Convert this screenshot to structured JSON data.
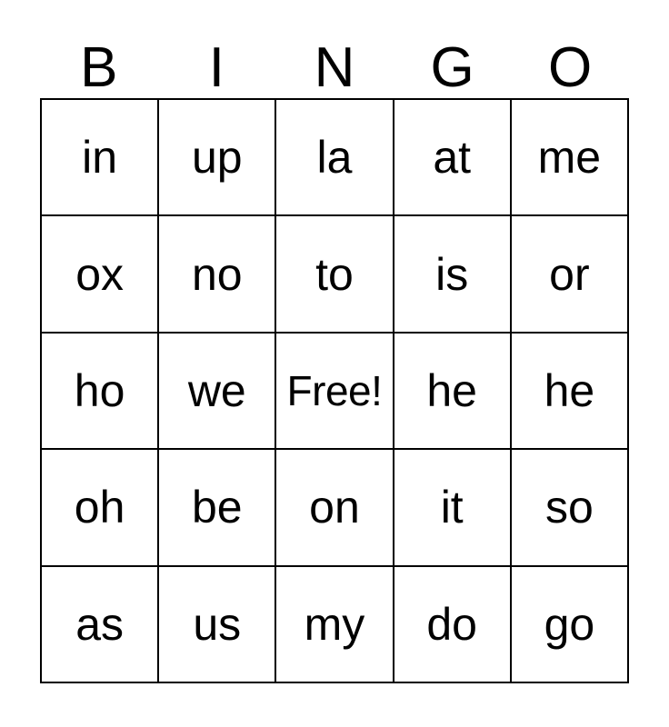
{
  "card": {
    "title_letters": [
      "B",
      "I",
      "N",
      "G",
      "O"
    ],
    "grid": [
      [
        "in",
        "up",
        "la",
        "at",
        "me"
      ],
      [
        "ox",
        "no",
        "to",
        "is",
        "or"
      ],
      [
        "ho",
        "we",
        "Free!",
        "he",
        "he"
      ],
      [
        "oh",
        "be",
        "on",
        "it",
        "so"
      ],
      [
        "as",
        "us",
        "my",
        "do",
        "go"
      ]
    ],
    "free_space": {
      "row": 2,
      "column": 2,
      "label": "Free!"
    },
    "colors": {
      "background": "#ffffff",
      "text": "#000000",
      "border": "#000000"
    }
  }
}
